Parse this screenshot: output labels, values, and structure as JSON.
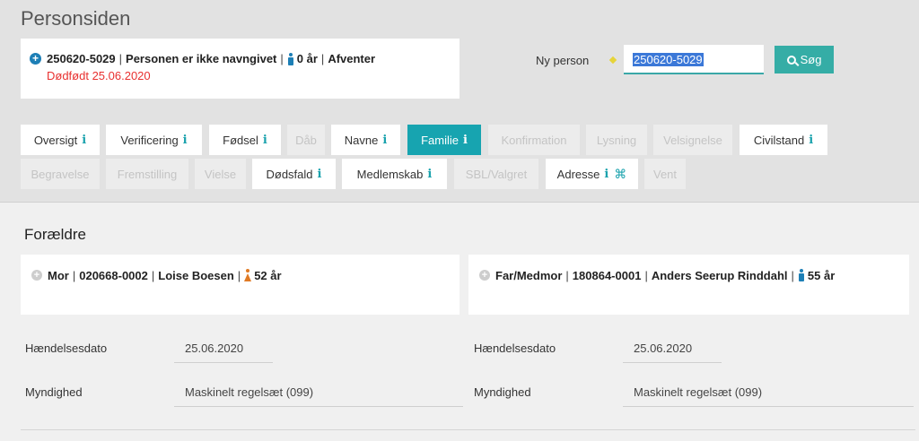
{
  "page": {
    "title": "Personsiden"
  },
  "person": {
    "cpr": "250620-5029",
    "name": "Personen er ikke navngivet",
    "age": "0 år",
    "status": "Afventer",
    "sep": "|",
    "deceased_line": "Dødfødt 25.06.2020"
  },
  "search": {
    "label": "Ny person",
    "value": "250620-5029",
    "button_label": "Søg",
    "button_icon": "search-icon"
  },
  "tabs": [
    {
      "label": "Oversigt",
      "state": "enabled",
      "info": "i"
    },
    {
      "label": "Verificering",
      "state": "enabled",
      "info": "i"
    },
    {
      "label": "Fødsel",
      "state": "enabled",
      "info": "i"
    },
    {
      "label": "Dåb",
      "state": "disabled",
      "info": ""
    },
    {
      "label": "Navne",
      "state": "enabled",
      "info": "i"
    },
    {
      "label": "Familie",
      "state": "active",
      "info": "i"
    },
    {
      "label": "Konfirmation",
      "state": "disabled",
      "info": ""
    },
    {
      "label": "Lysning",
      "state": "disabled",
      "info": ""
    },
    {
      "label": "Velsignelse",
      "state": "disabled",
      "info": ""
    },
    {
      "label": "Civilstand",
      "state": "enabled",
      "info": "i"
    },
    {
      "label": "Begravelse",
      "state": "disabled",
      "info": ""
    },
    {
      "label": "Fremstilling",
      "state": "disabled",
      "info": ""
    },
    {
      "label": "Vielse",
      "state": "disabled",
      "info": ""
    },
    {
      "label": "Dødsfald",
      "state": "enabled",
      "info": "i"
    },
    {
      "label": "Medlemskab",
      "state": "enabled",
      "info": "i"
    },
    {
      "label": "SBL/Valgret",
      "state": "disabled",
      "info": ""
    },
    {
      "label": "Adresse",
      "state": "enabled",
      "info": "i",
      "extra": "⌘"
    },
    {
      "label": "Vent",
      "state": "disabled",
      "info": ""
    }
  ],
  "section": {
    "title": "Forældre"
  },
  "parents": [
    {
      "role": "Mor",
      "cpr": "020668-0002",
      "name": "Loise Boesen",
      "age": "52 år",
      "gender_icon": "female-icon",
      "fields": [
        {
          "label": "Hændelsesdato",
          "value": "25.06.2020"
        },
        {
          "label": "Myndighed",
          "value": "Maskinelt regelsæt (099)"
        }
      ]
    },
    {
      "role": "Far/Medmor",
      "cpr": "180864-0001",
      "name": "Anders Seerup Rinddahl",
      "age": "55 år",
      "gender_icon": "male-icon",
      "fields": [
        {
          "label": "Hændelsesdato",
          "value": "25.06.2020"
        },
        {
          "label": "Myndighed",
          "value": "Maskinelt regelsæt (099)"
        }
      ]
    }
  ],
  "colors": {
    "accent": "#17a4b0",
    "button": "#35ada6",
    "deceased": "#e8302f",
    "male": "#1d7fb6",
    "female": "#e07a24"
  }
}
